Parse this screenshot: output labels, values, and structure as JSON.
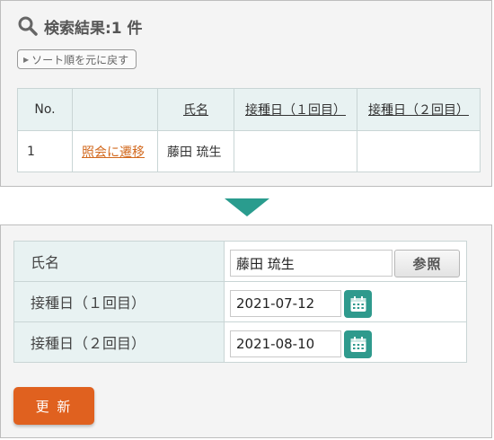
{
  "result_panel": {
    "title": "検索結果:1 件",
    "sort_reset_label": "ソート順を元に戻す",
    "table": {
      "headers": [
        "No.",
        "",
        "氏名",
        "接種日（１回目）",
        "接種日（２回目）"
      ],
      "rows": [
        {
          "no": "1",
          "link": "照会に遷移",
          "name": "藤田 琉生",
          "dose1": "",
          "dose2": ""
        }
      ]
    }
  },
  "edit_panel": {
    "fields": [
      {
        "label": "氏名",
        "value": "藤田 琉生",
        "button": "参照"
      },
      {
        "label": "接種日（１回目）",
        "value": "2021-07-12"
      },
      {
        "label": "接種日（２回目）",
        "value": "2021-08-10"
      }
    ],
    "update_label": "更 新"
  },
  "icons": [
    "search-icon",
    "calendar-icon",
    "down-arrow-icon"
  ],
  "colors": {
    "accent": "#2a9c8e",
    "update_button": "#e0611f",
    "link": "#d2691e",
    "header_bg": "#e8f2f2"
  }
}
